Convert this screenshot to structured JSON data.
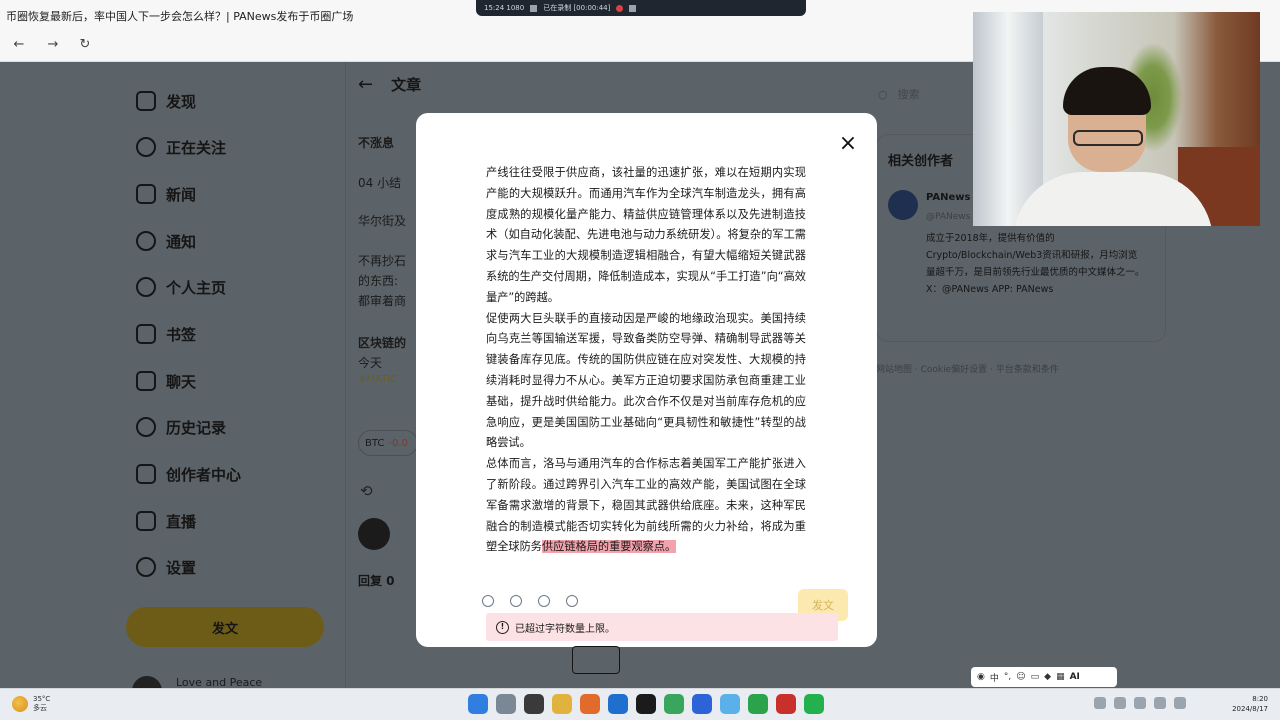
{
  "browser": {
    "tab_title": "币圈恢复最新后，率中国人下一步会怎么样？| PANews发布于币圈广场",
    "back": "←",
    "forward": "→",
    "refresh": "↻"
  },
  "recorder": {
    "left_text": "15:24 1080",
    "mid_text": "已在录制 [00:00:44]"
  },
  "sidebar": {
    "items": [
      {
        "label": "发现"
      },
      {
        "label": "正在关注"
      },
      {
        "label": "新闻"
      },
      {
        "label": "通知"
      },
      {
        "label": "个人主页"
      },
      {
        "label": "书签"
      },
      {
        "label": "聊天"
      },
      {
        "label": "历史记录"
      },
      {
        "label": "创作者中心"
      },
      {
        "label": "直播"
      },
      {
        "label": "设置"
      }
    ],
    "post_button": "发文",
    "user_name": "Love and Peace"
  },
  "article": {
    "back": "←",
    "title": "文章",
    "bg_lines": [
      "不涨息",
      "04 小结",
      "华尔街及",
      "不再抄石",
      "的东西:",
      "都审着商",
      "区块链的",
      "今天"
    ],
    "tag": "#MATIC",
    "chip_coin": "BTC",
    "chip_change": "-0.0",
    "reply": "回复 0"
  },
  "right": {
    "search_placeholder": "搜索",
    "related_title": "相关创作者",
    "creator_name": "PANews",
    "creator_handle": "@PANews",
    "creator_desc": "成立于2018年，提供有价值的Crypto/Blockchain/Web3资讯和研报，月均浏览量超千万，是目前领先行业最优质的中文媒体之一。 X：@PANews APP: PANews",
    "footer": "网站地图 · Cookie偏好设置 · 平台条款和条件"
  },
  "modal": {
    "close": "×",
    "paragraphs": [
      "产线往往受限于供应商，该社量的迅速扩张，难以在短期内实现产能的大规模跃升。而通用汽车作为全球汽车制造龙头，拥有高度成熟的规模化量产能力、精益供应链管理体系以及先进制造技术（如自动化装配、先进电池与动力系统研发）。将复杂的军工需求与汽车工业的大规模制造逻辑相融合，有望大幅缩短关键武器系统的生产交付周期，降低制造成本，实现从“手工打造”向“高效量产”的跨越。",
      "促使两大巨头联手的直接动因是严峻的地缘政治现实。美国持续向乌克兰等国输送军援，导致备类防空导弹、精确制导武器等关键装备库存见底。传统的国防供应链在应对突发性、大规模的持续消耗时显得力不从心。美军方正迫切要求国防承包商重建工业基础，提升战时供给能力。此次合作不仅是对当前库存危机的应急响应，更是美国国防工业基础向“更具韧性和敏捷性”转型的战略尝试。",
      "总体而言，洛马与通用汽车的合作标志着美国军工产能扩张进入了新阶段。通过跨界引入汽车工业的高效产能，美国试图在全球军备需求激增的背景下，稳固其武器供给底座。未来，这种军民融合的制造模式能否切实转化为前线所需的火力补给，将成为重塑全球防务"
    ],
    "highlight": "供应链格局的重要观察点。",
    "post_button": "发文",
    "warning": "已超过字符数量上限。"
  },
  "floating_bar": {
    "ai_label": "AI"
  },
  "taskbar": {
    "weather_temp": "35°C",
    "weather_desc": "多云",
    "time": "8:20",
    "date": "2024/8/17"
  }
}
